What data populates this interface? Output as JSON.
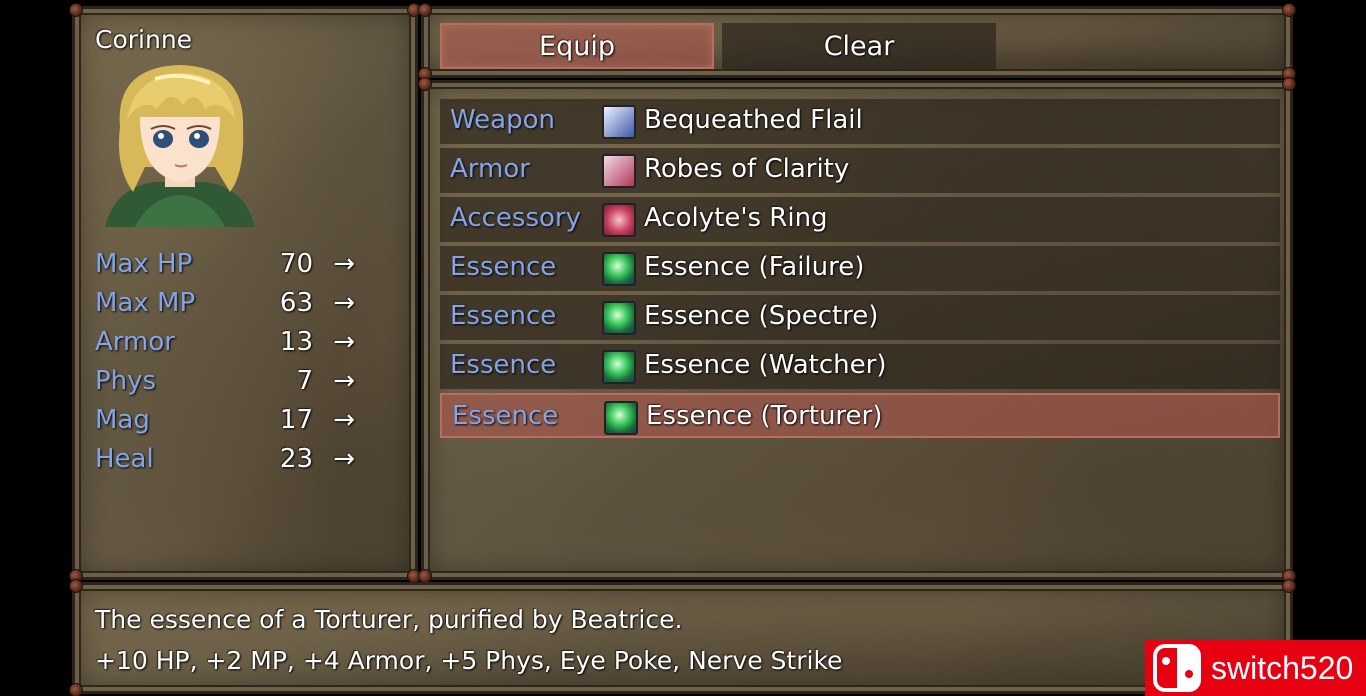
{
  "status": {
    "actor_name": "Corinne",
    "stats": [
      {
        "label": "Max HP",
        "value": "70"
      },
      {
        "label": "Max MP",
        "value": "63"
      },
      {
        "label": "Armor",
        "value": "13"
      },
      {
        "label": "Phys",
        "value": "7"
      },
      {
        "label": "Mag",
        "value": "17"
      },
      {
        "label": "Heal",
        "value": "23"
      }
    ],
    "arrow": "→"
  },
  "commands": {
    "equip": "Equip",
    "clear": "Clear",
    "selected": "equip"
  },
  "slots": [
    {
      "label": "Weapon",
      "icon": "flail-icon",
      "item": "Bequeathed Flail"
    },
    {
      "label": "Armor",
      "icon": "robe-icon",
      "item": "Robes of Clarity"
    },
    {
      "label": "Accessory",
      "icon": "ring-icon",
      "item": "Acolyte's Ring"
    },
    {
      "label": "Essence",
      "icon": "essence-orb-icon",
      "item": "Essence (Failure)"
    },
    {
      "label": "Essence",
      "icon": "essence-orb-icon",
      "item": "Essence (Spectre)"
    },
    {
      "label": "Essence",
      "icon": "essence-orb-icon",
      "item": "Essence (Watcher)"
    },
    {
      "label": "Essence",
      "icon": "essence-orb-icon",
      "item": "Essence (Torturer)"
    }
  ],
  "selected_slot": 6,
  "help": {
    "line1": "The essence of a Torturer, purified by Beatrice.",
    "line2": "+10 HP, +2 MP, +4 Armor, +5 Phys, Eye Poke, Nerve Strike"
  },
  "watermark": {
    "text": "switch520",
    "color": "#e60012"
  },
  "colors": {
    "system_text": "#84a4e6",
    "normal_text": "#ffffff",
    "selection": "#b96d5f"
  }
}
